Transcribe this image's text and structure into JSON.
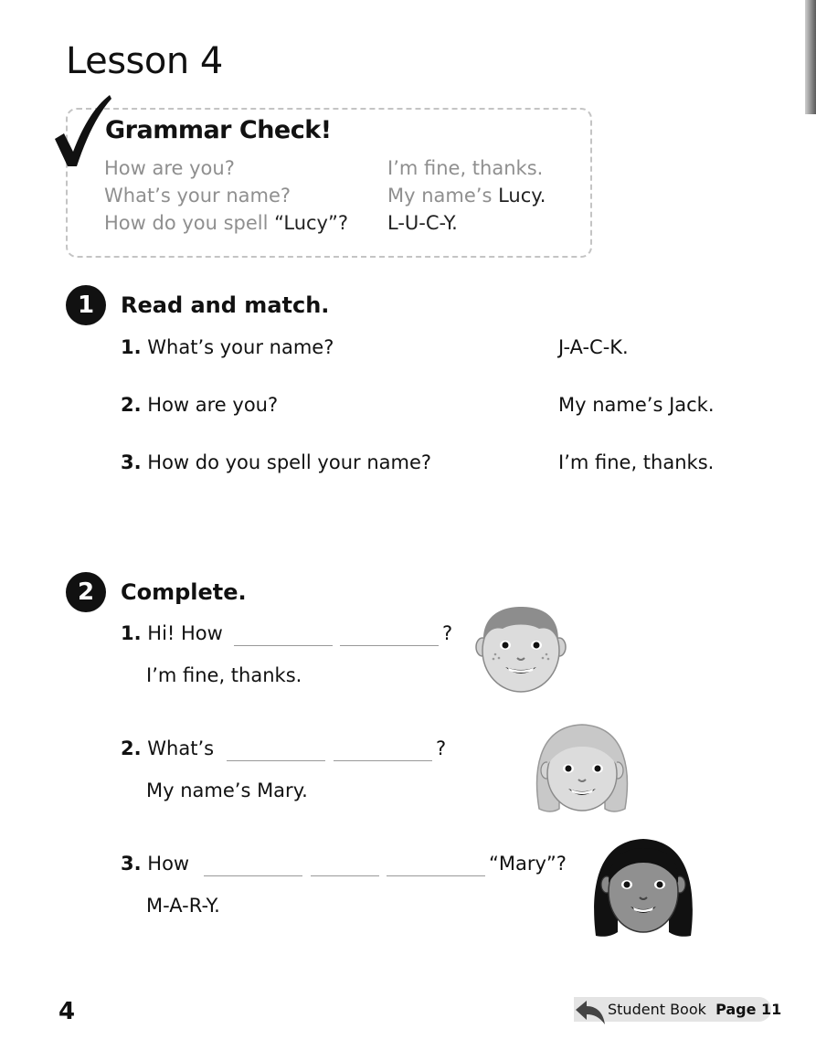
{
  "lesson_title": "Lesson 4",
  "grammar_check": {
    "title": "Grammar Check!",
    "rows": [
      {
        "q": "How are you?",
        "q_dark": "",
        "q_after": "",
        "a": "I’m fine, thanks.",
        "a_dark": ""
      },
      {
        "q": "What’s your name?",
        "q_dark": "",
        "q_after": "",
        "a": "My name’s ",
        "a_dark": "Lucy."
      },
      {
        "q": "How do you spell ",
        "q_dark": "“Lucy”?",
        "q_after": "",
        "a": "",
        "a_dark": "L-U-C-Y."
      }
    ]
  },
  "exercise1": {
    "number": "1",
    "title": "Read and match.",
    "questions": [
      {
        "num": "1.",
        "text": "What’s your name?"
      },
      {
        "num": "2.",
        "text": "How are you?"
      },
      {
        "num": "3.",
        "text": "How do you spell your name?"
      }
    ],
    "answers": [
      "J-A-C-K.",
      "My name’s Jack.",
      "I’m fine, thanks."
    ]
  },
  "exercise2": {
    "number": "2",
    "title": "Complete.",
    "items": [
      {
        "num": "1.",
        "prefix": "Hi! How",
        "suffix": "?",
        "answer": "I’m fine, thanks."
      },
      {
        "num": "2.",
        "prefix": "What’s",
        "suffix": "?",
        "answer": "My name’s Mary."
      },
      {
        "num": "3.",
        "prefix": "How",
        "suffix": "“Mary”?",
        "answer": "M-A-R-Y."
      }
    ]
  },
  "footer": {
    "page_number": "4",
    "student_book_label": "Student Book",
    "page_ref": "Page 11"
  },
  "colors": {
    "gray_text": "#8f8f8f",
    "dashed_border": "#c4c4c4",
    "tag_bg": "#e4e4e4"
  }
}
